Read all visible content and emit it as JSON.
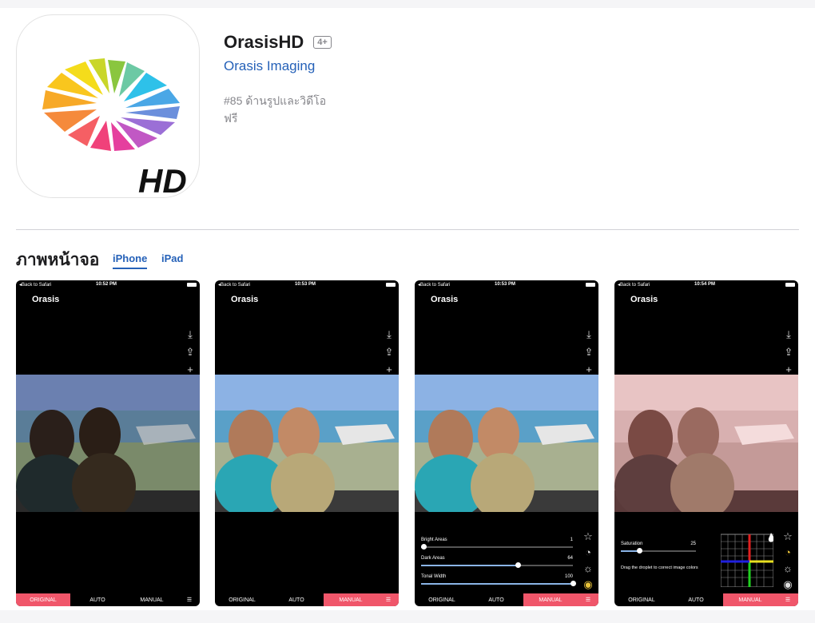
{
  "app": {
    "title": "OrasisHD",
    "age_rating": "4+",
    "developer": "Orasis Imaging",
    "rank": "#85 ด้านรูปและวิดีโอ",
    "price": "ฟรี",
    "icon_label": "HD"
  },
  "screenshots_section": {
    "title": "ภาพหน้าจอ",
    "tabs": [
      {
        "label": "iPhone",
        "active": true
      },
      {
        "label": "iPad",
        "active": false
      }
    ]
  },
  "screenshots": [
    {
      "back": "◂Back to Safari",
      "time": "10:52 PM",
      "app_name": "Orasis",
      "tabs": [
        "ORIGINAL",
        "AUTO",
        "MANUAL"
      ],
      "active_tab": "ORIGINAL"
    },
    {
      "back": "◂Back to Safari",
      "time": "10:53 PM",
      "app_name": "Orasis",
      "tabs": [
        "ORIGINAL",
        "AUTO",
        "MANUAL"
      ],
      "active_tab": "MANUAL"
    },
    {
      "back": "◂Back to Safari",
      "time": "10:53 PM",
      "app_name": "Orasis",
      "tabs": [
        "ORIGINAL",
        "AUTO",
        "MANUAL"
      ],
      "active_tab": "MANUAL",
      "sliders": [
        {
          "label": "Bright Areas",
          "value": "1",
          "fraction": 0.01
        },
        {
          "label": "Dark Areas",
          "value": "64",
          "fraction": 0.64
        },
        {
          "label": "Tonal Width",
          "value": "100",
          "fraction": 1.0
        }
      ]
    },
    {
      "back": "◂Back to Safari",
      "time": "10:54 PM",
      "app_name": "Orasis",
      "tabs": [
        "ORIGINAL",
        "AUTO",
        "MANUAL"
      ],
      "active_tab": "MANUAL",
      "saturation": {
        "label": "Saturation",
        "value": "25",
        "fraction": 0.25
      },
      "hint": "Drag the droplet to correct image colors"
    }
  ],
  "colors": {
    "accent_blue": "#2561b8",
    "tab_active": "#f0566a",
    "gold_icon": "#e8c23a"
  },
  "icons": [
    "download-icon",
    "share-icon",
    "plus-icon",
    "save-icon",
    "star-icon",
    "palette-icon",
    "sun-icon",
    "eye-icon",
    "settings-sliders-icon",
    "droplet-icon"
  ]
}
